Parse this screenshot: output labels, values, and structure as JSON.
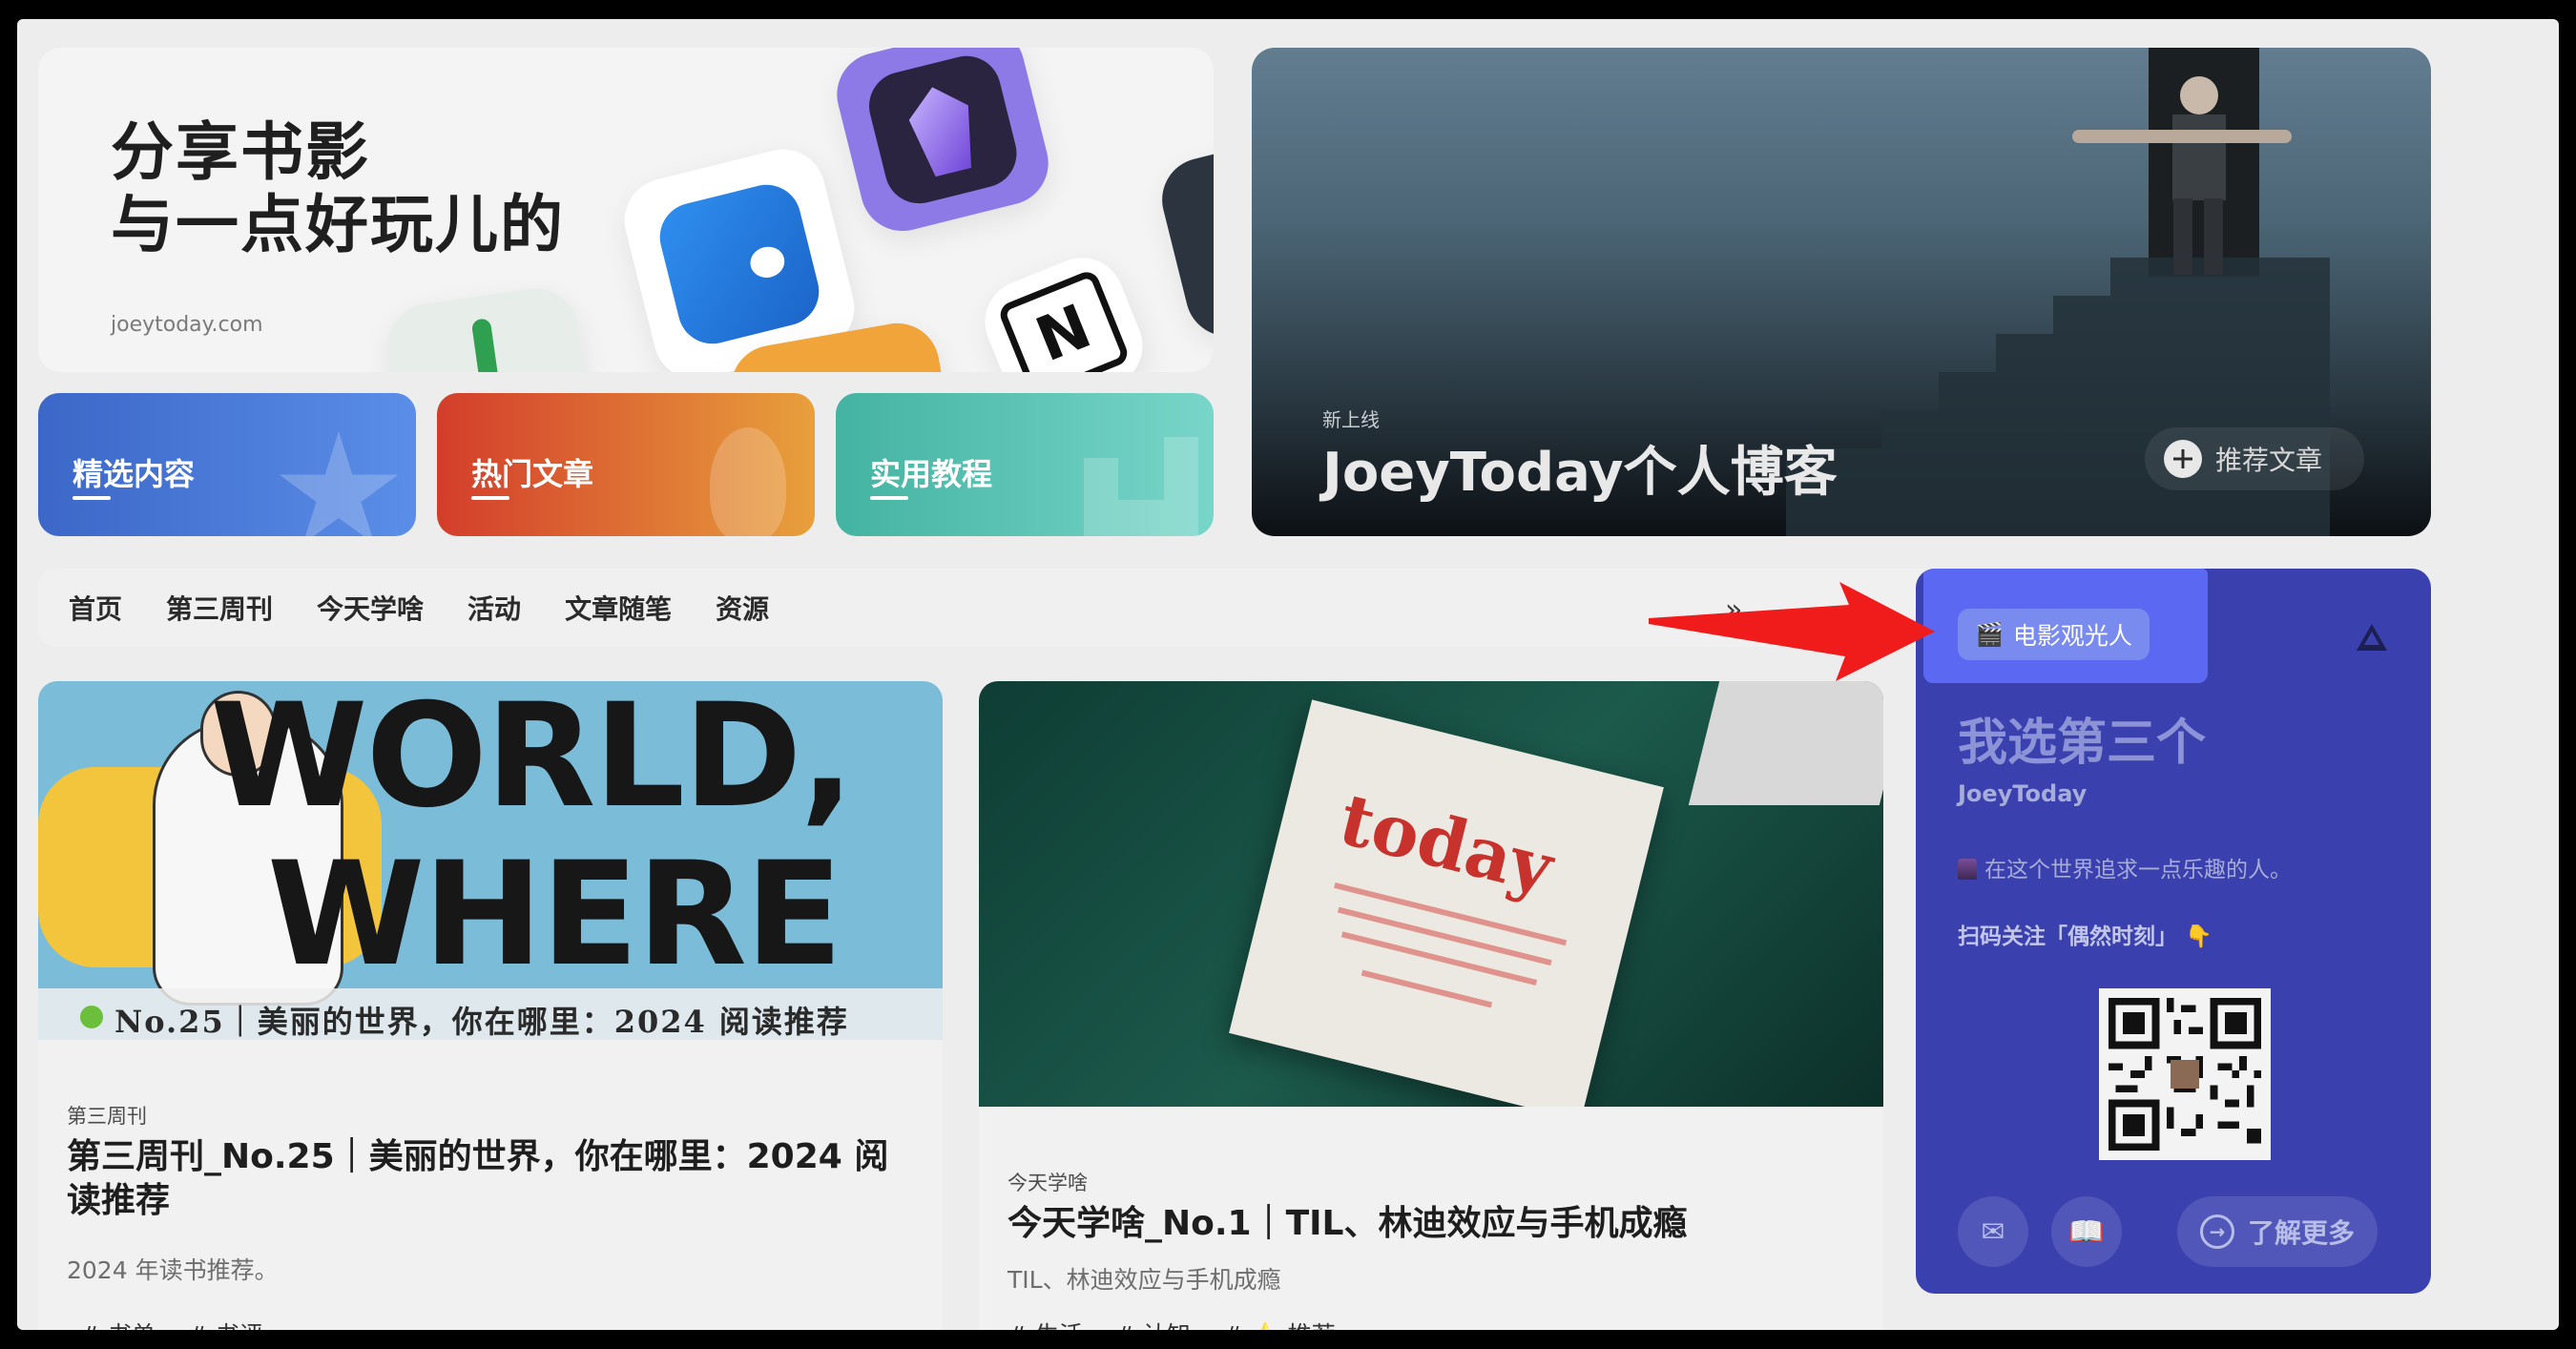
{
  "hero": {
    "brand_title_line1": "分享书影",
    "brand_title_line2": "与一点好玩儿的",
    "brand_domain": "joeytoday.com"
  },
  "categories": [
    {
      "label": "精选内容",
      "color_from": "#3c67c8",
      "color_to": "#5a8ee8"
    },
    {
      "label": "热门文章",
      "color_from": "#d33d2b",
      "color_to": "#e8a03c"
    },
    {
      "label": "实用教程",
      "color_from": "#44b3a2",
      "color_to": "#78d6c9"
    }
  ],
  "featured": {
    "eyebrow": "新上线",
    "title": "JoeyToday个人博客",
    "recommend_label": "推荐文章"
  },
  "nav": {
    "items": [
      "首页",
      "第三周刊",
      "今天学啥",
      "活动",
      "文章随笔",
      "资源"
    ],
    "more_icon": "»"
  },
  "articles": [
    {
      "cover_headline_1": "WORLD,",
      "cover_headline_2": "WHERE",
      "cover_caption": "No.25｜美丽的世界，你在哪里：2024 阅读推荐",
      "category": "第三周刊",
      "title": "第三周刊_No.25｜美丽的世界，你在哪里：2024 阅读推荐",
      "excerpt": "2024 年读书推荐。",
      "tags": [
        "# 书单",
        "# 书评"
      ]
    },
    {
      "cover_label_word": "today",
      "category": "今天学啥",
      "title": "今天学啥_No.1｜TIL、林迪效应与手机成瘾",
      "excerpt": "TIL、林迪效应与手机成瘾",
      "tags": [
        "# 生活",
        "# 认知",
        "# ⭐ 推荐"
      ]
    }
  ],
  "profile": {
    "badge": "电影观光人",
    "badge_icon": "clapper-icon",
    "heading": "我选第三个",
    "name": "JoeyToday",
    "bio": "在这个世界追求一点乐趣的人。",
    "follow_text": "扫码关注「偶然时刻」",
    "follow_emoji": "👇",
    "learn_more": "了解更多",
    "accent": "#3a40ad"
  },
  "colors": {
    "annotation_arrow": "#f01c1c",
    "highlight": "#5a68f2"
  }
}
